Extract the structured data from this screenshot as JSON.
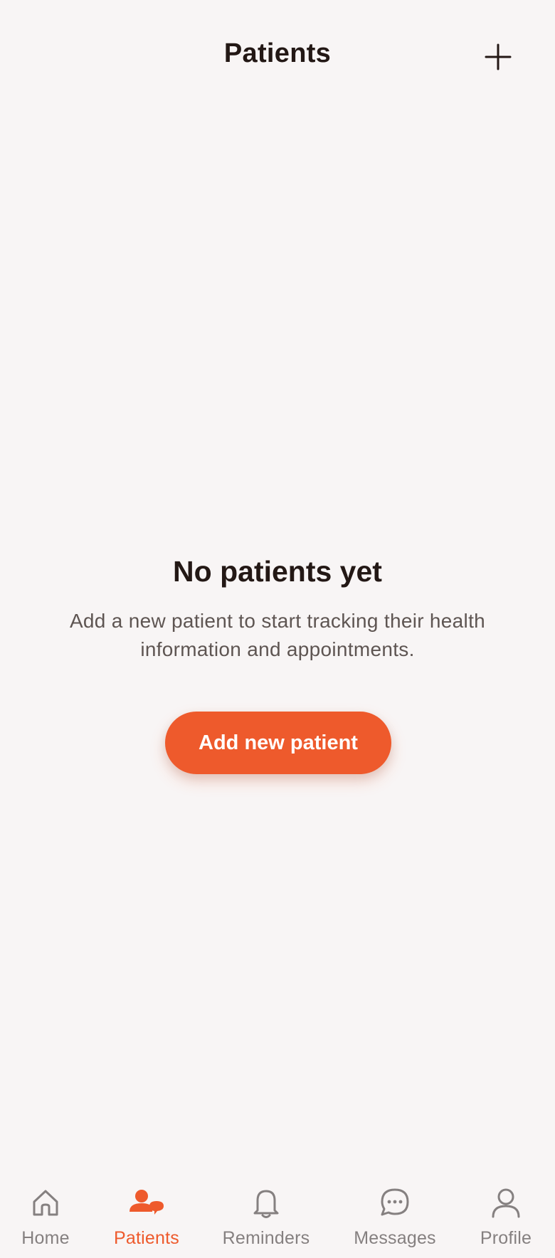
{
  "header": {
    "title": "Patients"
  },
  "icons": {
    "add": "plus-icon",
    "home": "home-icon",
    "patients": "patients-icon",
    "reminders": "bell-icon",
    "messages": "chat-bubble-icon",
    "profile": "user-icon"
  },
  "empty_state": {
    "title": "No patients yet",
    "description": "Add a new patient to start tracking their health information and appointments.",
    "button_label": "Add new patient"
  },
  "tabs": [
    {
      "label": "Home",
      "active": false
    },
    {
      "label": "Patients",
      "active": true
    },
    {
      "label": "Reminders",
      "active": false
    },
    {
      "label": "Messages",
      "active": false
    },
    {
      "label": "Profile",
      "active": false
    }
  ],
  "colors": {
    "accent": "#ee5a2c",
    "background": "#f8f5f5",
    "text_primary": "#231815",
    "text_secondary": "#5e5552",
    "tab_inactive": "#858080"
  }
}
